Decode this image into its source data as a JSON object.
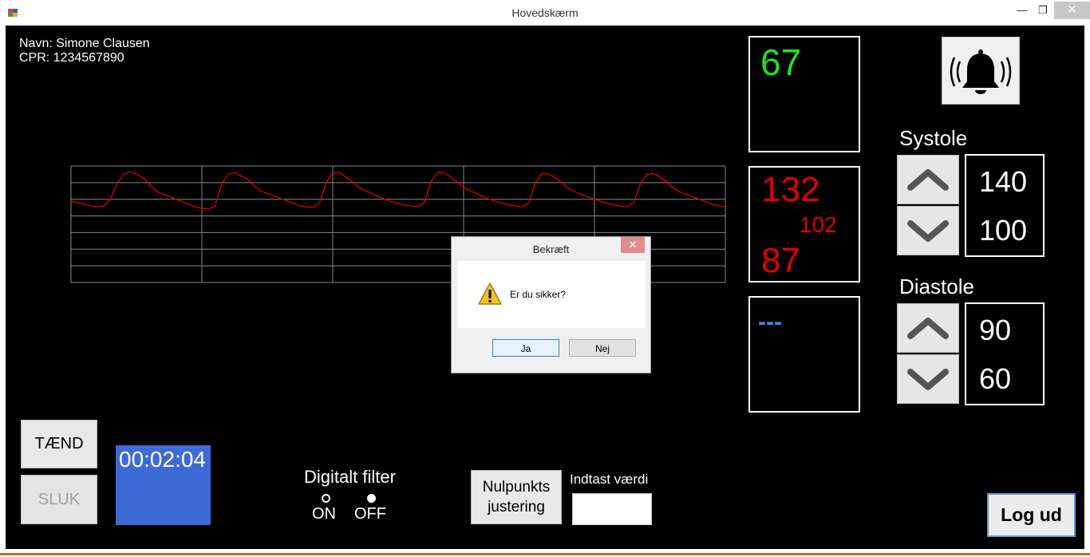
{
  "window": {
    "title": "Hovedskærm",
    "minimize_glyph": "—",
    "maximize_glyph": "❐",
    "close_glyph": "✕"
  },
  "patient": {
    "name_line": "Navn: Simone Clausen",
    "cpr_line": "CPR: 1234567890"
  },
  "vitals": {
    "pulse": "67",
    "systolic": "132",
    "mean": "102",
    "diastolic": "87",
    "third": "---",
    "colors": {
      "pulse": "#22e022",
      "pressure": "#e00000",
      "third": "#3a8fe8"
    }
  },
  "alarm": {
    "icon": "bell-icon"
  },
  "systole": {
    "label": "Systole",
    "upper": "140",
    "lower": "100"
  },
  "diastole": {
    "label": "Diastole",
    "upper": "90",
    "lower": "60"
  },
  "controls": {
    "on_label": "TÆND",
    "off_label": "SLUK",
    "timer": "00:02:04",
    "filter_label": "Digitalt filter",
    "filter_on": "ON",
    "filter_off": "OFF",
    "filter_selected": "OFF",
    "zero_line1": "Nulpunkts",
    "zero_line2": "justering",
    "input_label": "Indtast værdi",
    "input_value": "",
    "logout_label": "Log ud"
  },
  "dialog": {
    "title": "Bekræft",
    "message": "Er du sikker?",
    "yes_label": "Ja",
    "no_label": "Nej",
    "close_glyph": "✕"
  },
  "chart_data": {
    "type": "line",
    "title": "",
    "xlabel": "",
    "ylabel": "",
    "series_color": "#e00000",
    "grid": true,
    "ylim": [
      0,
      140
    ],
    "x": [
      0,
      0.05,
      0.1,
      0.15,
      0.2,
      0.25,
      0.3,
      0.35,
      0.4,
      0.45,
      0.5,
      0.55,
      0.6,
      0.65,
      0.7,
      0.75,
      0.8,
      0.85,
      0.9,
      0.95,
      1.0,
      1.05,
      1.1,
      1.15,
      1.2,
      1.25,
      1.3,
      1.35,
      1.4,
      1.45,
      1.5,
      1.55,
      1.6,
      1.65,
      1.7,
      1.75,
      1.8,
      1.85,
      1.9,
      1.95,
      2.0,
      2.05,
      2.1,
      2.15,
      2.2,
      2.25,
      2.3,
      2.35,
      2.4,
      2.45,
      2.5,
      2.55,
      2.6,
      2.65,
      2.7,
      2.75,
      2.8,
      2.85,
      2.9,
      2.95,
      3.0,
      3.05,
      3.1,
      3.15,
      3.2,
      3.25,
      3.3,
      3.35,
      3.4,
      3.45,
      3.5,
      3.55,
      3.6,
      3.65,
      3.7,
      3.75,
      3.8,
      3.85,
      3.9,
      3.95,
      4.0,
      4.05,
      4.1,
      4.15,
      4.2,
      4.25,
      4.3,
      4.35,
      4.4,
      4.45,
      4.5,
      4.55,
      4.6,
      4.65,
      4.7,
      4.75,
      4.8,
      4.85,
      4.9,
      4.95,
      5.0
    ],
    "y": [
      98,
      96,
      94,
      92,
      91,
      92,
      100,
      118,
      130,
      133,
      130,
      126,
      118,
      110,
      106,
      104,
      100,
      97,
      94,
      91,
      89,
      88,
      92,
      118,
      130,
      132,
      128,
      124,
      116,
      110,
      107,
      104,
      101,
      98,
      95,
      92,
      91,
      90,
      96,
      120,
      132,
      132,
      127,
      121,
      114,
      110,
      107,
      103,
      100,
      97,
      95,
      93,
      92,
      91,
      96,
      121,
      132,
      132,
      127,
      121,
      114,
      110,
      107,
      103,
      100,
      97,
      95,
      93,
      92,
      91,
      96,
      120,
      131,
      130,
      126,
      120,
      113,
      109,
      106,
      103,
      100,
      97,
      95,
      93,
      92,
      91,
      96,
      118,
      130,
      131,
      127,
      121,
      114,
      109,
      106,
      103,
      100,
      97,
      94,
      92,
      91
    ]
  }
}
